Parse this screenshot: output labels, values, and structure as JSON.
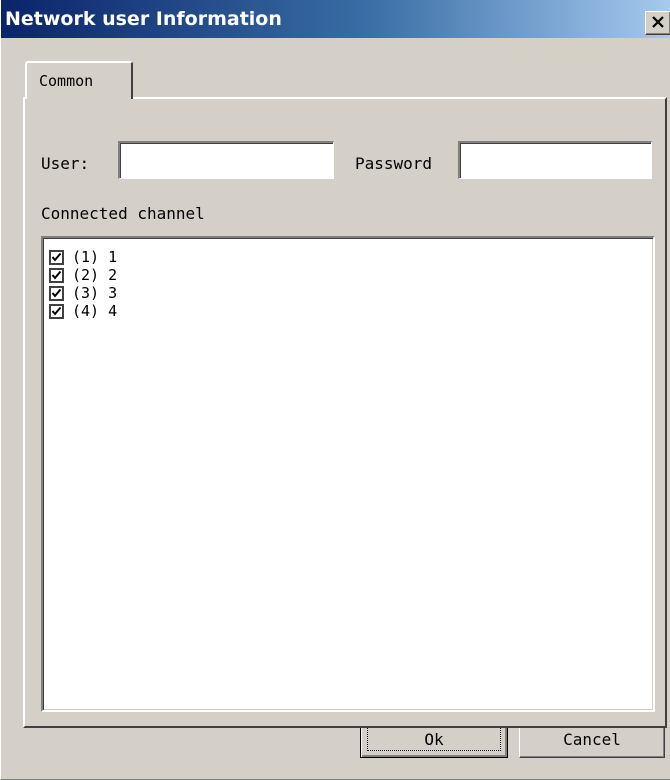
{
  "window": {
    "title": "Network user Information",
    "close_icon": "close-icon"
  },
  "tabs": [
    {
      "label": "Common",
      "selected": true
    }
  ],
  "form": {
    "user_label": "User:",
    "user_value": "",
    "password_label": "Password",
    "password_value": ""
  },
  "channels": {
    "label": "Connected channel",
    "items": [
      {
        "label": "(1) 1",
        "checked": true
      },
      {
        "label": "(2) 2",
        "checked": true
      },
      {
        "label": "(3) 3",
        "checked": true
      },
      {
        "label": "(4) 4",
        "checked": true
      }
    ]
  },
  "buttons": {
    "ok": "Ok",
    "cancel": "Cancel"
  },
  "colors": {
    "title_gradient_start": "#0a246a",
    "title_gradient_end": "#a6caf0",
    "dialog_face": "#d4d0c8"
  }
}
